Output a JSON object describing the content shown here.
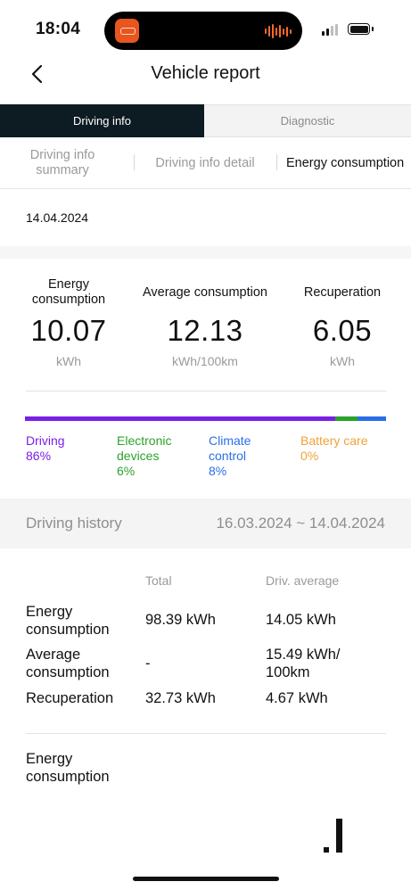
{
  "status_bar": {
    "time": "18:04"
  },
  "header": {
    "title": "Vehicle report"
  },
  "main_tabs": [
    {
      "label": "Driving info",
      "active": true
    },
    {
      "label": "Diagnostic",
      "active": false
    }
  ],
  "sub_tabs": [
    {
      "label": "Driving info summary",
      "active": false
    },
    {
      "label": "Driving info detail",
      "active": false
    },
    {
      "label": "Energy consumption",
      "active": true
    }
  ],
  "date": "14.04.2024",
  "stats": [
    {
      "label": "Energy consumption",
      "value": "10.07",
      "unit": "kWh"
    },
    {
      "label": "Average consumption",
      "value": "12.13",
      "unit": "kWh/100km"
    },
    {
      "label": "Recuperation",
      "value": "6.05",
      "unit": "kWh"
    }
  ],
  "breakdown": [
    {
      "label": "Driving",
      "percent_label": "86%",
      "percent": 86,
      "color": "#7a1fe6"
    },
    {
      "label": "Electronic devices",
      "percent_label": "6%",
      "percent": 6,
      "color": "#2aa32a"
    },
    {
      "label": "Climate control",
      "percent_label": "8%",
      "percent": 8,
      "color": "#2a6ee8"
    },
    {
      "label": "Battery care",
      "percent_label": "0%",
      "percent": 0,
      "color": "#f0a23a"
    }
  ],
  "history": {
    "label": "Driving history",
    "range": "16.03.2024 ~ 14.04.2024",
    "columns": [
      "Total",
      "Driv. average"
    ],
    "rows": [
      {
        "label": "Energy consumption",
        "total": "98.39 kWh",
        "average": "14.05 kWh"
      },
      {
        "label": "Average consumption",
        "total": "-",
        "average": "15.49 kWh/ 100km"
      },
      {
        "label": "Recuperation",
        "total": "32.73 kWh",
        "average": "4.67 kWh"
      }
    ]
  },
  "chart": {
    "title": "Energy consumption"
  }
}
